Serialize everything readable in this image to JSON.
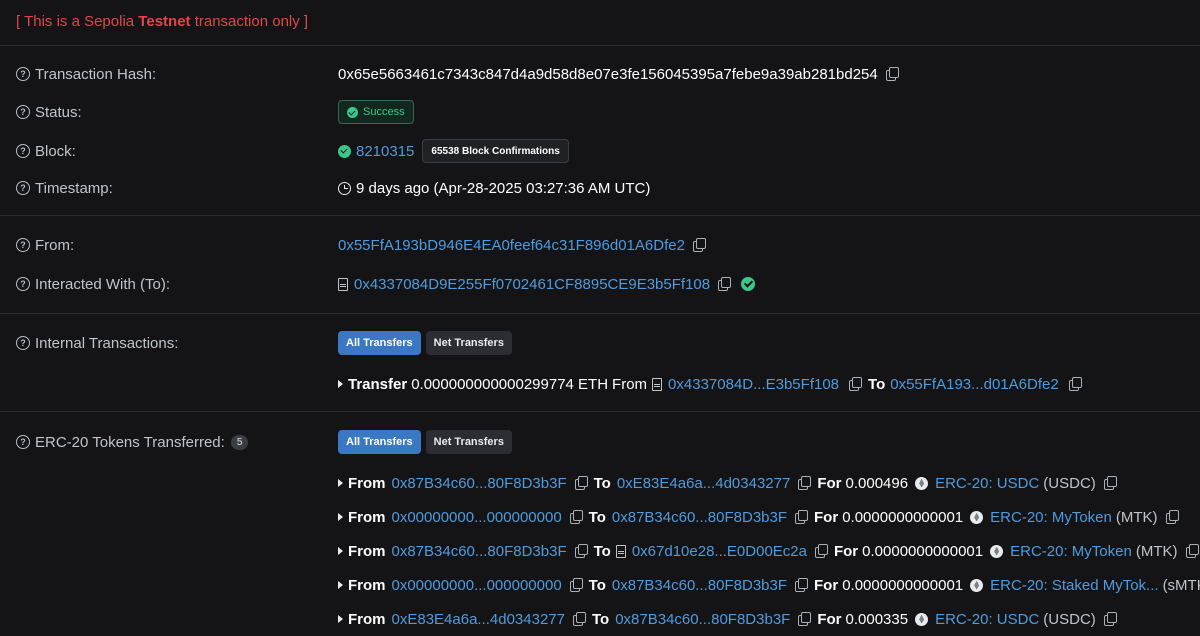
{
  "testnet": {
    "prefix": "[ This is a Sepolia ",
    "bold": "Testnet",
    "suffix": " transaction only ]"
  },
  "overview": {
    "hash_label": "Transaction Hash:",
    "hash_value": "0x65e5663461c7343c847d4a9d58d8e07e3fe156045395a7febe9a39ab281bd254",
    "status_label": "Status:",
    "status_value": "Success",
    "block_label": "Block:",
    "block_value": "8210315",
    "block_confirmations": "65538 Block Confirmations",
    "timestamp_label": "Timestamp:",
    "timestamp_value": "9 days ago (Apr-28-2025 03:27:36 AM UTC)"
  },
  "parties": {
    "from_label": "From:",
    "from_value": "0x55FfA193bD946E4EA0feef64c31F896d01A6Dfe2",
    "to_label": "Interacted With (To):",
    "to_value": "0x4337084D9E255Ff0702461CF8895CE9E3b5Ff108"
  },
  "internal": {
    "label": "Internal Transactions:",
    "tab_all": "All Transfers",
    "tab_net": "Net Transfers",
    "transfer_word": "Transfer",
    "amount": "0.000000000000299774 ETH",
    "from_word": "From",
    "from_addr": "0x4337084D...E3b5Ff108",
    "to_word": "To",
    "to_addr": "0x55FfA193...d01A6Dfe2"
  },
  "erc20": {
    "label": "ERC-20 Tokens Transferred:",
    "count": "5",
    "tab_all": "All Transfers",
    "tab_net": "Net Transfers",
    "from_word": "From",
    "to_word": "To",
    "for_word": "For",
    "rows": [
      {
        "from": "0x87B34c60...80F8D3b3F",
        "to": "0xE83E4a6a...4d0343277",
        "amount": "0.000496",
        "token": "ERC-20: USDC",
        "symbol": "(USDC)"
      },
      {
        "from": "0x00000000...000000000",
        "to": "0x87B34c60...80F8D3b3F",
        "amount": "0.0000000000001",
        "token": "ERC-20: MyToken",
        "symbol": "(MTK)"
      },
      {
        "from": "0x87B34c60...80F8D3b3F",
        "to": "0x67d10e28...E0D00Ec2a",
        "amount": "0.0000000000001",
        "token": "ERC-20: MyToken",
        "symbol": "(MTK)"
      },
      {
        "from": "0x00000000...000000000",
        "to": "0x87B34c60...80F8D3b3F",
        "amount": "0.0000000000001",
        "token": "ERC-20: Staked MyTok...",
        "symbol": "(sMTK)"
      },
      {
        "from": "0xE83E4a6a...4d0343277",
        "to": "0x87B34c60...80F8D3b3F",
        "amount": "0.000335",
        "token": "ERC-20: USDC",
        "symbol": "(USDC)"
      }
    ]
  }
}
